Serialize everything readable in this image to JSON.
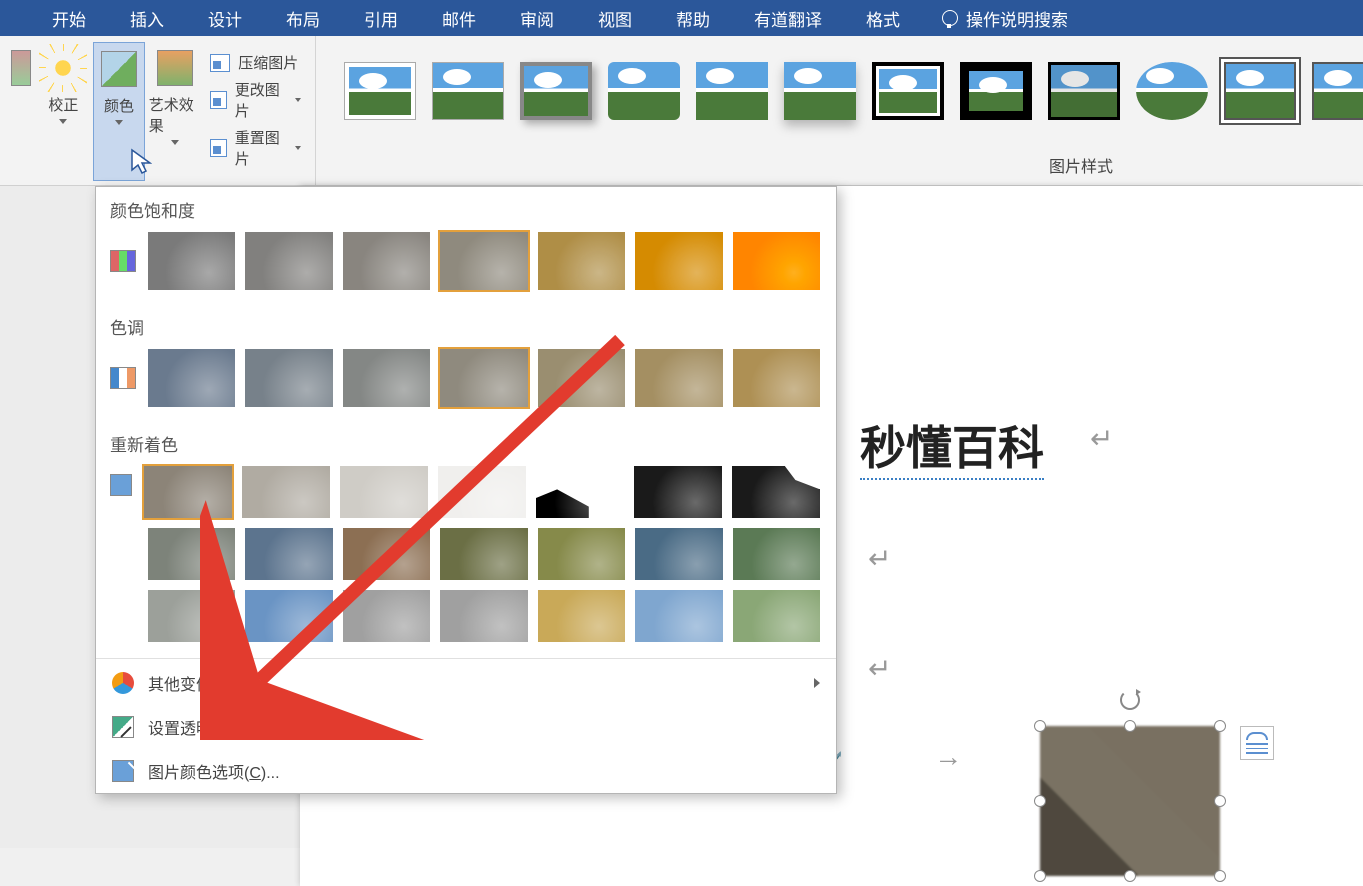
{
  "ribbon": {
    "tabs": [
      "开始",
      "插入",
      "设计",
      "布局",
      "引用",
      "邮件",
      "审阅",
      "视图",
      "帮助",
      "有道翻译",
      "格式"
    ],
    "active_tab": "格式",
    "tell_me": "操作说明搜索"
  },
  "adjust_group": {
    "corrections": "校正",
    "color": "颜色",
    "artistic": "艺术效果",
    "compress": "压缩图片",
    "change": "更改图片",
    "reset": "重置图片"
  },
  "styles_group_label": "图片样式",
  "color_panel": {
    "sections": {
      "saturation": "颜色饱和度",
      "tone": "色调",
      "recolor": "重新着色"
    },
    "saturation_tints": [
      "#7e7a73",
      "#83807a",
      "#8a857c",
      "#8f8a7e",
      "#a58f5f",
      "#b38e49",
      "#c08c33"
    ],
    "tone_tints": [
      "#6a7a8e",
      "#77818a",
      "#848785",
      "#8f8a7e",
      "#9a8e70",
      "#a48f62",
      "#ae9054"
    ],
    "recolor_rows": [
      [
        "#8c8478",
        "#b0aba2",
        "#cfccc6",
        "#f0efed",
        "#524d45",
        "#1a1a1a",
        "#1a1a1a"
      ],
      [
        "#7d837a",
        "#5c748e",
        "#8c6f53",
        "#6b6f45",
        "#868a4a",
        "#4a6b85",
        "#5b7a55"
      ],
      [
        "#9ca09a",
        "#6a94c4",
        "#a0a0a0",
        "#a0a0a0",
        "#c9a958",
        "#7fa6cf",
        "#8aa776"
      ]
    ],
    "menu_items": {
      "variants": "其他变体(M)",
      "transparent": "设置透明色(S)",
      "options": "图片颜色选项(C)..."
    }
  },
  "document": {
    "watermark": "秒懂百科"
  }
}
